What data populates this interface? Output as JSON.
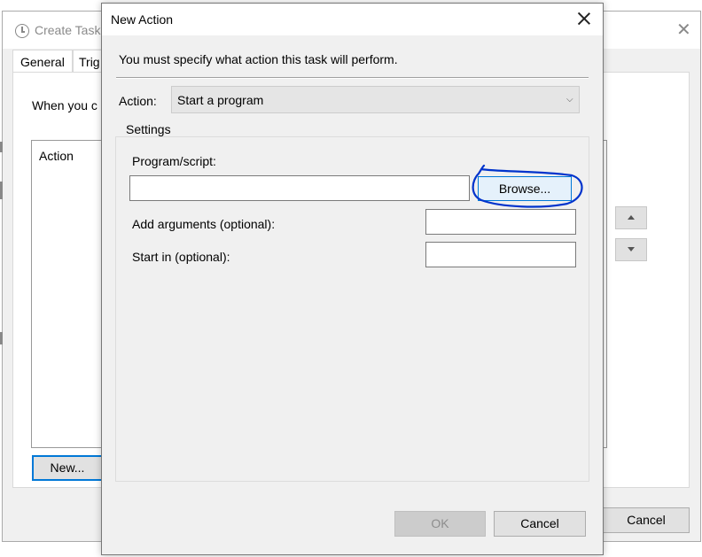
{
  "background_window": {
    "title": "Create Task",
    "tabs": [
      "General",
      "Trig"
    ],
    "when_text": "When you c",
    "list_column_header": "Action",
    "new_button": "New...",
    "cancel_button": "Cancel"
  },
  "dialog": {
    "title": "New Action",
    "instruction": "You must specify what action this task will perform.",
    "action_label": "Action:",
    "action_value": "Start a program",
    "settings_label": "Settings",
    "program_label": "Program/script:",
    "program_value": "",
    "browse_button": "Browse...",
    "arguments_label": "Add arguments (optional):",
    "arguments_value": "",
    "start_in_label": "Start in (optional):",
    "start_in_value": "",
    "ok_button": "OK",
    "cancel_button": "Cancel"
  },
  "annotation_color": "#0033cc"
}
